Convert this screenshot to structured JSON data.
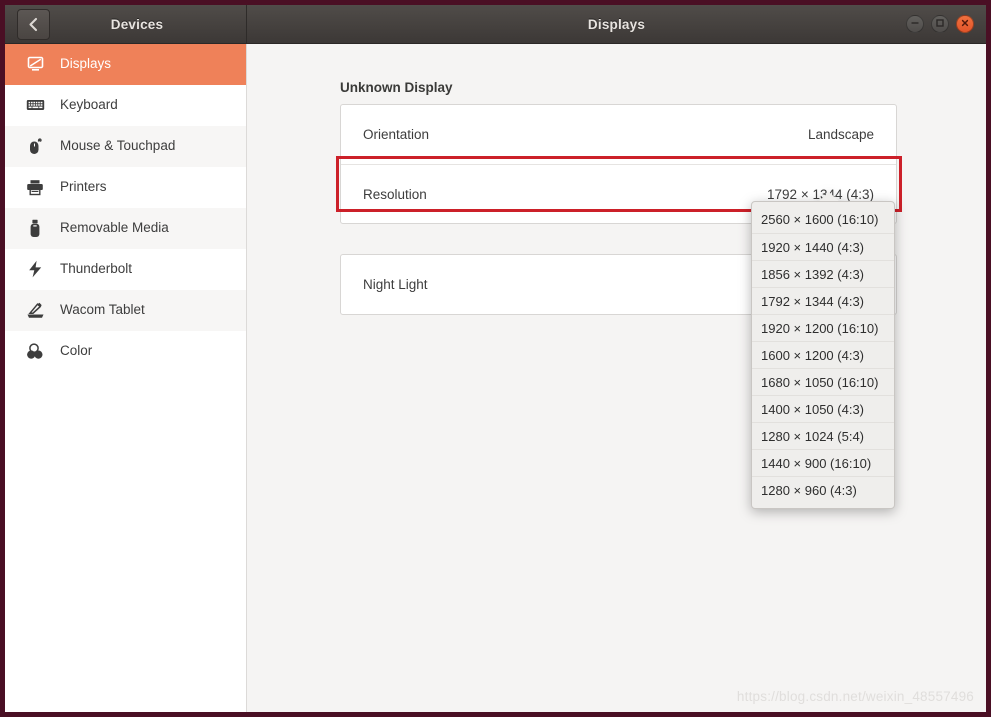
{
  "window": {
    "left_title": "Devices",
    "center_title": "Displays",
    "back_icon": "chevron-left-icon",
    "controls": [
      {
        "name": "minimize-button",
        "icon": "minimize-icon"
      },
      {
        "name": "maximize-button",
        "icon": "maximize-icon"
      },
      {
        "name": "close-button",
        "icon": "close-icon"
      }
    ],
    "accent_close": "#e2552a",
    "titlebar_bg": "#3c3836",
    "frame_color": "#4a0f24"
  },
  "sidebar": {
    "active_color": "#ef8159",
    "items": [
      {
        "label": "Displays",
        "icon": "monitor-icon",
        "active": true
      },
      {
        "label": "Keyboard",
        "icon": "keyboard-icon",
        "active": false
      },
      {
        "label": "Mouse & Touchpad",
        "icon": "mouse-icon",
        "active": false
      },
      {
        "label": "Printers",
        "icon": "printer-icon",
        "active": false
      },
      {
        "label": "Removable Media",
        "icon": "usb-drive-icon",
        "active": false
      },
      {
        "label": "Thunderbolt",
        "icon": "thunderbolt-icon",
        "active": false
      },
      {
        "label": "Wacom Tablet",
        "icon": "wacom-tablet-icon",
        "active": false
      },
      {
        "label": "Color",
        "icon": "color-circles-icon",
        "active": false
      }
    ]
  },
  "main": {
    "section_title": "Unknown Display",
    "rows": [
      {
        "label": "Orientation",
        "value": "Landscape"
      },
      {
        "label": "Resolution",
        "value": "1792 × 1344 (4:3)"
      }
    ],
    "night_light": {
      "label": "Night Light",
      "value": ""
    }
  },
  "annotation": {
    "color": "#cc2029",
    "target": "resolution-row"
  },
  "dropdown": {
    "open": true,
    "selected": "1792 × 1344 (4:3)",
    "options": [
      "2560 × 1600 (16:10)",
      "1920 × 1440 (4:3)",
      "1856 × 1392 (4:3)",
      "1792 × 1344 (4:3)",
      "1920 × 1200 (16:10)",
      "1600 × 1200 (4:3)",
      "1680 × 1050 (16:10)",
      "1400 × 1050 (4:3)",
      "1280 × 1024 (5:4)",
      "1440 × 900 (16:10)",
      "1280 × 960 (4:3)"
    ]
  },
  "watermark": {
    "text": "https://blog.csdn.net/weixin_48557496"
  }
}
